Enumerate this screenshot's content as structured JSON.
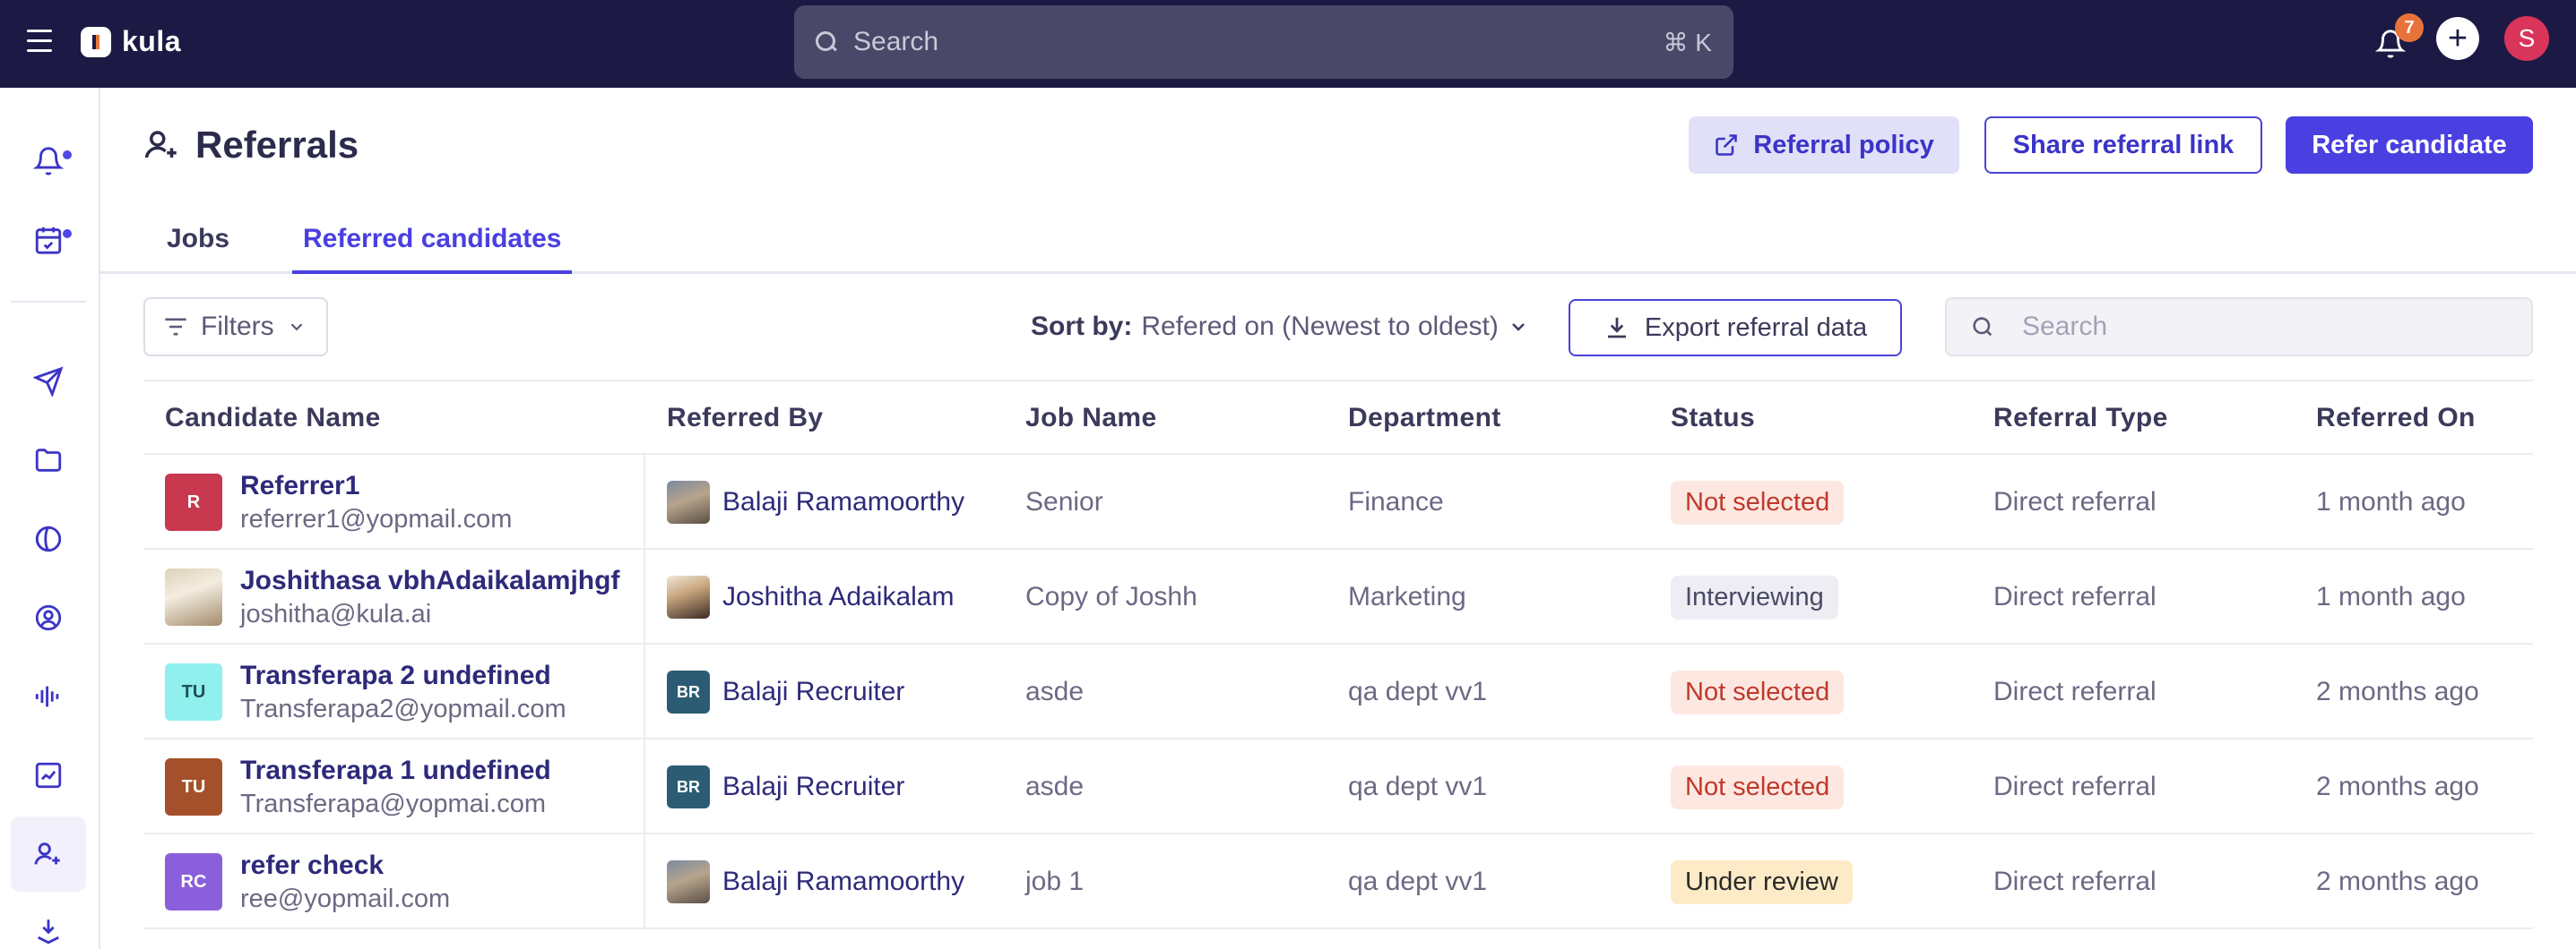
{
  "topbar": {
    "brand": "kula",
    "search_placeholder": "Search",
    "search_shortcut": "⌘ K",
    "notification_count": "7",
    "user_initial": "S"
  },
  "header": {
    "title": "Referrals",
    "policy_button": "Referral policy",
    "share_button": "Share referral link",
    "refer_button": "Refer candidate"
  },
  "tabs": {
    "jobs": "Jobs",
    "referred": "Referred candidates"
  },
  "toolbar": {
    "filters": "Filters",
    "sort_label": "Sort by:",
    "sort_value": "Refered on (Newest to oldest)",
    "export": "Export referral data",
    "search_placeholder": "Search"
  },
  "table": {
    "headers": [
      "Candidate Name",
      "Referred By",
      "Job Name",
      "Department",
      "Status",
      "Referral Type",
      "Referred On"
    ],
    "rows": [
      {
        "initials": "R",
        "avatar_color": "#c8384f",
        "name": "Referrer1",
        "email": "referrer1@yopmail.com",
        "ref_initials": "",
        "ref_name": "Balaji Ramamoorthy",
        "job": "Senior",
        "dept": "Finance",
        "status": "Not selected",
        "type": "Direct referral",
        "on": "1 month ago"
      },
      {
        "initials": "",
        "avatar_color": "",
        "name": "Joshithasa vbhAdaikalamjhgf",
        "email": "joshitha@kula.ai",
        "ref_initials": "",
        "ref_name": "Joshitha Adaikalam",
        "job": "Copy of Joshh",
        "dept": "Marketing",
        "status": "Interviewing",
        "type": "Direct referral",
        "on": "1 month ago"
      },
      {
        "initials": "TU",
        "avatar_color": "#8ff0ee",
        "name": "Transferapa 2 undefined",
        "email": "Transferapa2@yopmail.com",
        "ref_initials": "BR",
        "ref_name": "Balaji Recruiter",
        "job": "asde",
        "dept": "qa dept vv1",
        "status": "Not selected",
        "type": "Direct referral",
        "on": "2 months ago"
      },
      {
        "initials": "TU",
        "avatar_color": "#a4502a",
        "name": "Transferapa 1 undefined",
        "email": "Transferapa@yopmai.com",
        "ref_initials": "BR",
        "ref_name": "Balaji Recruiter",
        "job": "asde",
        "dept": "qa dept vv1",
        "status": "Not selected",
        "type": "Direct referral",
        "on": "2 months ago"
      },
      {
        "initials": "RC",
        "avatar_color": "#8b5fdc",
        "name": "refer check",
        "email": "ree@yopmail.com",
        "ref_initials": "",
        "ref_name": "Balaji Ramamoorthy",
        "job": "job 1",
        "dept": "qa dept vv1",
        "status": "Under review",
        "type": "Direct referral",
        "on": "2 months ago"
      }
    ]
  },
  "colors": {
    "topbar": "#1c1a44",
    "accent": "#4a3fe0",
    "not_selected_bg": "#fde8e1",
    "not_selected_fg": "#c0392b",
    "interviewing_bg": "#ededf3",
    "interviewing_fg": "#4a4966",
    "under_review_bg": "#fdebc7",
    "under_review_fg": "#2b2b2b",
    "br_avatar": "#2c5c73"
  }
}
